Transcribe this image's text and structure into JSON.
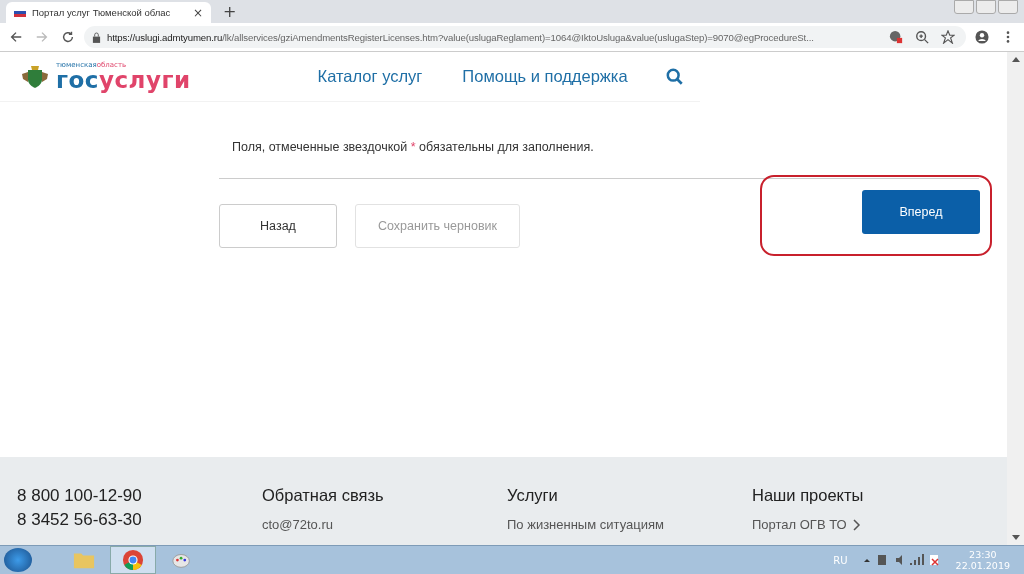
{
  "browser": {
    "tab_title": "Портал услуг Тюменской облас",
    "tab_close": "×",
    "new_tab": "+",
    "url_host": "https://uslugi.admtyumen.ru",
    "url_path": "/lk/allservices/gziAmendmentsRegisterLicenses.htm?value(uslugaReglament)=1064@IktoUsluga&value(uslugaStep)=9070@egProcedureSt..."
  },
  "header": {
    "logo_region_a": "тюменская",
    "logo_region_b": "область",
    "logo_gos": "гос",
    "logo_uslugi": "услуги",
    "nav": [
      "Каталог услуг",
      "Помощь и поддержка"
    ]
  },
  "form": {
    "note_before": "Поля, отмеченные звездочкой",
    "note_mark": "*",
    "note_after": "обязательны для заполнения.",
    "buttons": [
      {
        "label": "Назад",
        "kind": "secondary",
        "disabled": false
      },
      {
        "label": "Сохранить черновик",
        "kind": "secondary",
        "disabled": true
      },
      {
        "label": "Вперед",
        "kind": "primary",
        "disabled": false,
        "highlighted": true
      }
    ]
  },
  "footer": {
    "phones": [
      "8 800 100-12-90",
      "8 3452 56-63-30"
    ],
    "columns": [
      {
        "title": "Обратная связь",
        "links": [
          "cto@72to.ru"
        ],
        "arrow": false
      },
      {
        "title": "Услуги",
        "links": [
          "По жизненным ситуациям"
        ],
        "arrow": false
      },
      {
        "title": "Наши проекты",
        "links": [
          "Портал ОГВ ТО"
        ],
        "arrow": true
      }
    ]
  },
  "taskbar": {
    "language": "RU",
    "time": "23:30",
    "date": "22.01.2019"
  }
}
